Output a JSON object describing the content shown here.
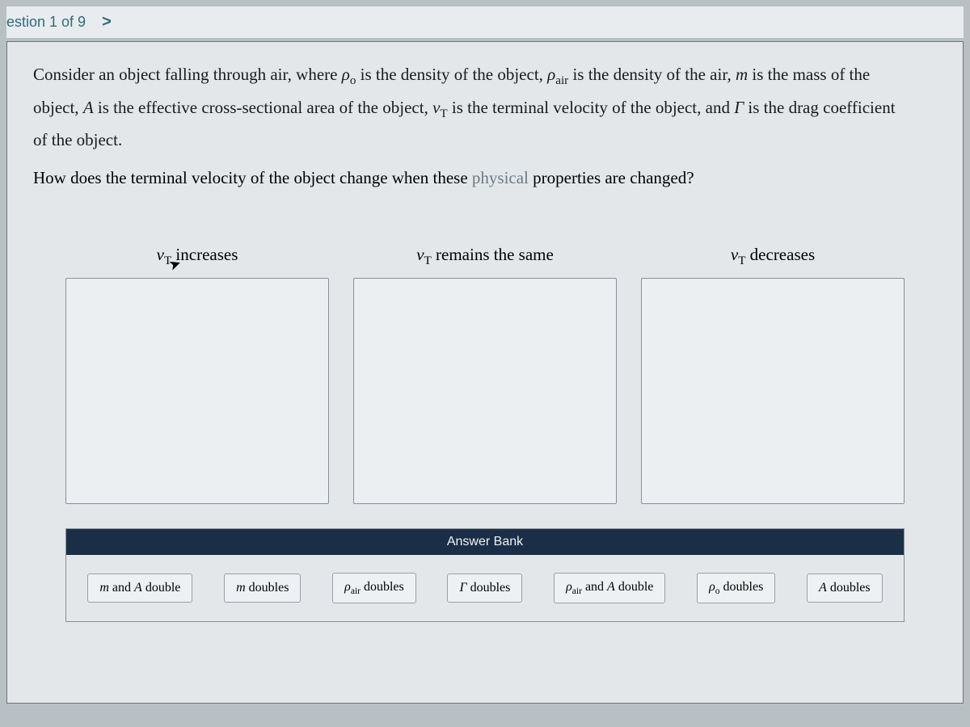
{
  "nav": {
    "label": "estion 1 of 9",
    "next_arrow": ">"
  },
  "prompt": {
    "line1_a": "Consider an object falling through air, where ",
    "rho_o": "ρ",
    "rho_o_sub": "o",
    "line1_b": " is the density of the object, ",
    "rho_air": "ρ",
    "rho_air_sub": "air",
    "line1_c": " is the density of the air, ",
    "m": "m",
    "line1_d": " is the mass of the",
    "line2_a": "object, ",
    "A": "A",
    "line2_b": " is the effective cross-sectional area of the object, ",
    "vT": "v",
    "vT_sub": "T",
    "line2_c": " is the terminal velocity of the object, and ",
    "Gamma": "Γ",
    "line2_d": " is the drag coefficient",
    "line3": "of the object.",
    "question_a": "How does the terminal velocity of the object change when these ",
    "question_faded": "physical",
    "question_b": " properties are changed?"
  },
  "categories": {
    "col1": {
      "prefix": "v",
      "sub": "T",
      "suffix": " increases"
    },
    "col2": {
      "prefix": "v",
      "sub": "T",
      "suffix": " remains the same"
    },
    "col3": {
      "prefix": "v",
      "sub": "T",
      "suffix": " decreases"
    }
  },
  "answer_bank": {
    "title": "Answer Bank",
    "chips": [
      {
        "html_prefix": "m",
        "mid": " and ",
        "html_mid": "A",
        "suffix": " double"
      },
      {
        "html_prefix": "m",
        "suffix": " doubles"
      },
      {
        "html_prefix": "ρ",
        "sub": "air",
        "suffix": " doubles"
      },
      {
        "html_prefix": "Γ",
        "suffix": " doubles"
      },
      {
        "html_prefix": "ρ",
        "sub": "air",
        "mid": " and ",
        "html_mid": "A",
        "suffix": " double"
      },
      {
        "html_prefix": "ρ",
        "sub": "o",
        "suffix": " doubles"
      },
      {
        "html_prefix": "A",
        "suffix": " doubles"
      }
    ]
  }
}
